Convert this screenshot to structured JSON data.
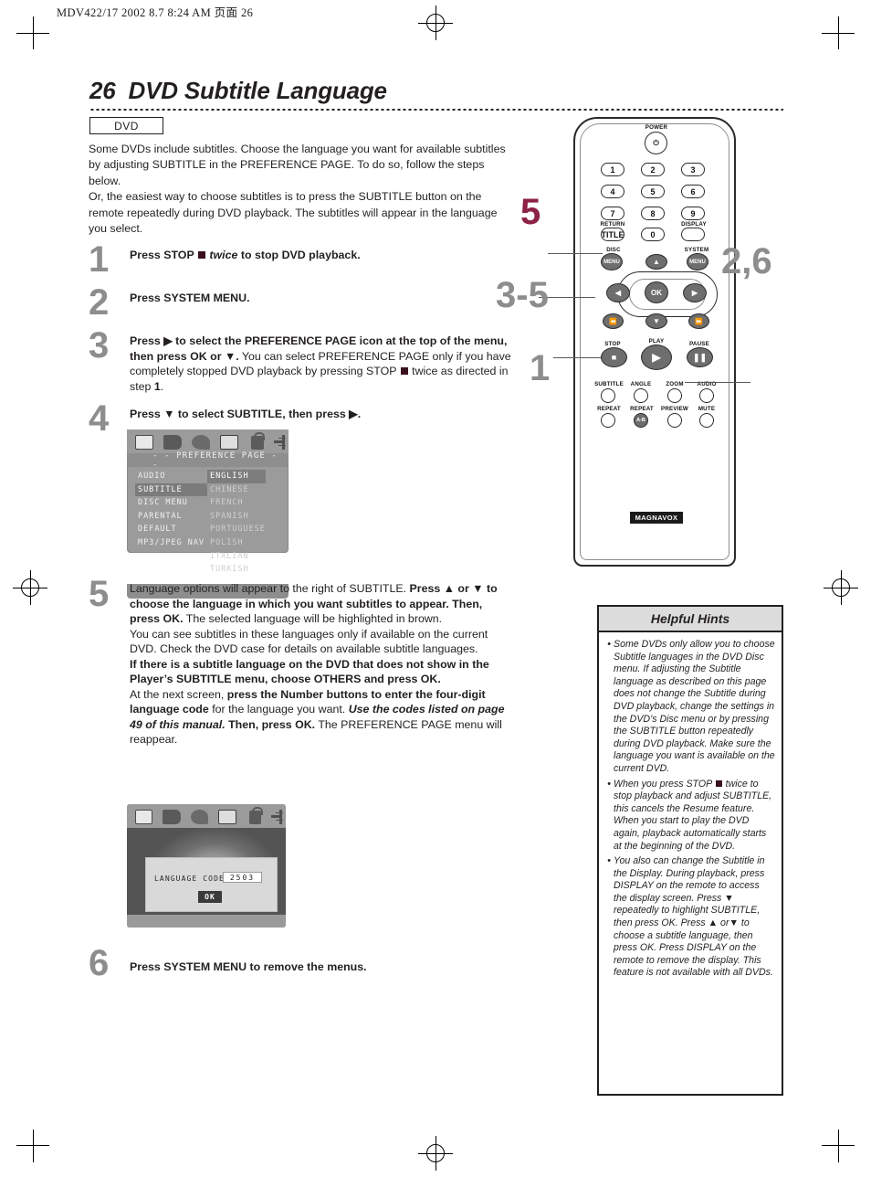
{
  "slug": "MDV422/17   2002 8.7   8:24 AM  页面 26",
  "page": {
    "number": "26",
    "title": "DVD Subtitle Language",
    "tag": "DVD"
  },
  "intro": [
    "Some DVDs include subtitles. Choose the language you want for available subtitles by adjusting SUBTITLE in the PREFERENCE PAGE. To do so, follow the steps below.",
    "Or, the easiest way to choose subtitles is to press the SUBTITLE button on the remote repeatedly during DVD playback. The subtitles will appear in the language you select."
  ],
  "steps": [
    {
      "num": "1",
      "text_html": "<b>Press STOP <span class='sq'></span> <i>twice</i> to stop DVD playback.</b>"
    },
    {
      "num": "2",
      "text_html": "<b>Press SYSTEM MENU.</b>"
    },
    {
      "num": "3",
      "text_html": "<b>Press ▶ to select the PREFERENCE PAGE icon at the top of the menu, then press OK or ▼.</b> You can select PREFERENCE PAGE only if you have completely stopped DVD playback by pressing STOP <span class='sq'></span> twice as directed in step <b>1</b>."
    },
    {
      "num": "4",
      "text_html": "<b>Press ▼ to select SUBTITLE, then press ▶.</b>"
    },
    {
      "num": "5",
      "text_html": "Language options will appear to the right of SUBTITLE. <b>Press ▲ or ▼ to choose the language in which you want subtitles to appear. Then, press OK.</b> The selected language will be highlighted in brown.<br>You can see subtitles in these languages only if available on the current DVD. Check the DVD case for details on available subtitle languages.<br><b>If there is a subtitle language on the DVD that does not show in the Player’s SUBTITLE menu, choose OTHERS and press OK.</b><br>At the next screen, <b>press the Number buttons to enter the four-digit language code</b> for the language you want. <b><i>Use the codes listed on page 49 of this manual.</i> Then, press OK.</b> The PREFERENCE PAGE menu will reappear."
    },
    {
      "num": "6",
      "text_html": "<b>Press SYSTEM MENU to remove the menus.</b>"
    }
  ],
  "osd_preference": {
    "icons": [
      "disc-icon",
      "speaker-icon",
      "satellite-icon",
      "preference-page-icon",
      "lock-icon",
      "exit-icon"
    ],
    "title": "- -  PREFERENCE  PAGE  - -",
    "menu_items": [
      "AUDIO",
      "SUBTITLE",
      "DISC  MENU",
      "PARENTAL",
      "DEFAULT",
      "MP3/JPEG  NAV"
    ],
    "menu_selected": "SUBTITLE",
    "languages": [
      "ENGLISH",
      "CHINESE",
      "FRENCH",
      "SPANISH",
      "PORTUGUESE",
      "POLISH",
      "ITALIAN",
      "TURKISH"
    ],
    "language_selected": "ENGLISH"
  },
  "osd_language_code": {
    "label": "LANGUAGE  CODE",
    "code": "2503",
    "ok_label": "OK"
  },
  "remote": {
    "power_label": "POWER",
    "number_buttons": [
      "1",
      "2",
      "3",
      "4",
      "5",
      "6",
      "7",
      "8",
      "9",
      "0"
    ],
    "return_label": "RETURN",
    "title_label": "TITLE",
    "display_label": "DISPLAY",
    "disc_label": "DISC",
    "disc_menu_label": "MENU",
    "system_label": "SYSTEM",
    "system_menu_label": "MENU",
    "ok_label": "OK",
    "stop_label": "STOP",
    "play_label": "PLAY",
    "pause_label": "PAUSE",
    "feature_row1": [
      "SUBTITLE",
      "ANGLE",
      "ZOOM",
      "AUDIO"
    ],
    "feature_row2": [
      "REPEAT",
      "REPEAT",
      "PREVIEW",
      "MUTE"
    ],
    "repeat_ab_label": "A-B",
    "brand": "MAGNAVOX",
    "callouts": [
      {
        "label": "5",
        "color": "#8c2244"
      },
      {
        "label": "2,6",
        "color": "#8d8d8d"
      },
      {
        "label": "3-5",
        "color": "#8d8d8d"
      },
      {
        "label": "1",
        "color": "#8d8d8d"
      }
    ]
  },
  "hints": {
    "title": "Helpful Hints",
    "items_html": [
      "Some DVDs only allow you to choose Subtitle languages in the DVD Disc menu. If adjusting the Subtitle language as described on this page does not change the Subtitle during DVD playback, change the settings in the DVD’s Disc menu or by pressing the SUBTITLE button repeatedly during DVD playback. Make sure the language you want is available on the current DVD.",
      "When you press STOP <span class='sq'></span> twice to stop playback and adjust SUBTITLE, this cancels the Resume feature. When you start to play the DVD again, playback automatically starts at the beginning of the DVD.",
      "You also can change the Subtitle in the Display. During playback, press DISPLAY on the remote to access the display screen. Press ▼ repeatedly to highlight SUBTITLE, then press OK. Press ▲ or▼ to choose a subtitle language, then press OK. Press DISPLAY on the remote to remove the display. This feature is not available with all DVDs."
    ]
  },
  "colors": {
    "accent_maroon": "#8c2244",
    "step_gray": "#8d8d8d",
    "text": "#231f20"
  }
}
